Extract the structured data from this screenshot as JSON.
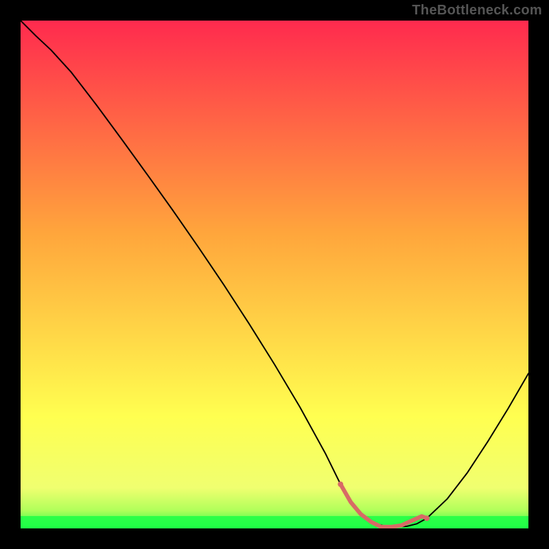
{
  "watermark": "TheBottleneck.com",
  "chart_data": {
    "type": "line",
    "title": "",
    "xlabel": "",
    "ylabel": "",
    "xlim": [
      0,
      100
    ],
    "ylim": [
      0,
      100
    ],
    "grid": false,
    "legend": false,
    "background_gradient": {
      "top": "#ff2a4e",
      "mid_upper": "#ffa63c",
      "mid_lower": "#ffff50",
      "bottom": "#1eff46"
    },
    "series": [
      {
        "name": "bottleneck-curve",
        "color": "#000000",
        "width": 2,
        "x": [
          0,
          3,
          6,
          10,
          15,
          20,
          25,
          30,
          35,
          40,
          45,
          50,
          55,
          60,
          63,
          66,
          68,
          70,
          72,
          74,
          76,
          78,
          80,
          84,
          88,
          92,
          96,
          100
        ],
        "y": [
          100,
          97,
          94.2,
          89.8,
          83.3,
          76.5,
          69.6,
          62.6,
          55.4,
          48.0,
          40.3,
          32.3,
          23.9,
          14.8,
          8.7,
          4.1,
          2.0,
          0.9,
          0.4,
          0.3,
          0.4,
          0.9,
          2.0,
          5.8,
          11.0,
          17.1,
          23.6,
          30.5
        ]
      },
      {
        "name": "highlight-band",
        "color": "#d86a66",
        "width": 6,
        "x": [
          63,
          65,
          67,
          69,
          71,
          73,
          75,
          77,
          79,
          80
        ],
        "y": [
          8.7,
          5.2,
          2.8,
          1.3,
          0.3,
          0.3,
          0.6,
          1.5,
          2.4,
          2.0
        ]
      }
    ]
  }
}
